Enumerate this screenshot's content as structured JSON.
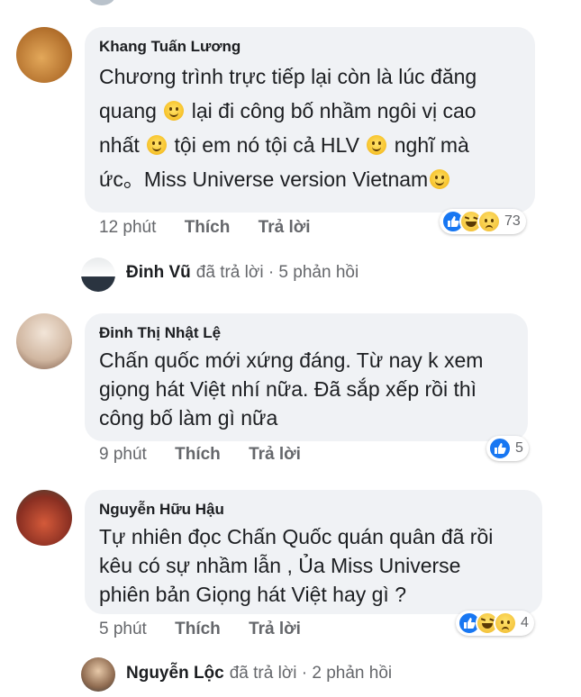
{
  "comments": [
    {
      "name": "Khang Tuấn Lương",
      "lines": [
        "Chương trình trực tiếp lại còn là lúc đăng",
        "quang",
        "lại đi công bố nhầm ngôi vị cao",
        "nhất",
        "tội em nó tội cả HLV",
        "nghĩ mà",
        "ức。Miss Universe version Vietnam"
      ],
      "time": "12 phút",
      "like_label": "Thích",
      "reply_label": "Trả lời",
      "reaction_count": "73",
      "avatar_color": "#c98a3f"
    },
    {
      "name": "Đinh Thị Nhật Lệ",
      "lines": [
        "Chấn quốc mới xứng đáng. Từ nay k xem",
        "giọng hát Việt nhí nữa. Đã sắp xếp rồi thì",
        "công bố làm gì nữa"
      ],
      "time": "9 phút",
      "like_label": "Thích",
      "reply_label": "Trả lời",
      "reaction_count": "5",
      "avatar_color": "#d8c6b8"
    },
    {
      "name": "Nguyễn Hữu Hậu",
      "lines": [
        "Tự nhiên đọc Chấn Quốc quán quân đã rồi",
        "kêu có sự nhầm lẫn , Ủa Miss Universe",
        "phiên bản Giọng hát Việt hay gì ?"
      ],
      "time": "5 phút",
      "like_label": "Thích",
      "reply_label": "Trả lời",
      "reaction_count": "4",
      "avatar_color": "#8a3a2c"
    }
  ],
  "replies": [
    {
      "name": "Đinh Vũ",
      "text": "đã trả lời · 5 phản hồi"
    },
    {
      "name": "Nguyễn Lộc",
      "text": "đã trả lời · 2 phản hồi"
    }
  ],
  "colors": {
    "bubble": "#f0f2f5",
    "meta": "#65676b",
    "like_blue": "#1877f2"
  }
}
